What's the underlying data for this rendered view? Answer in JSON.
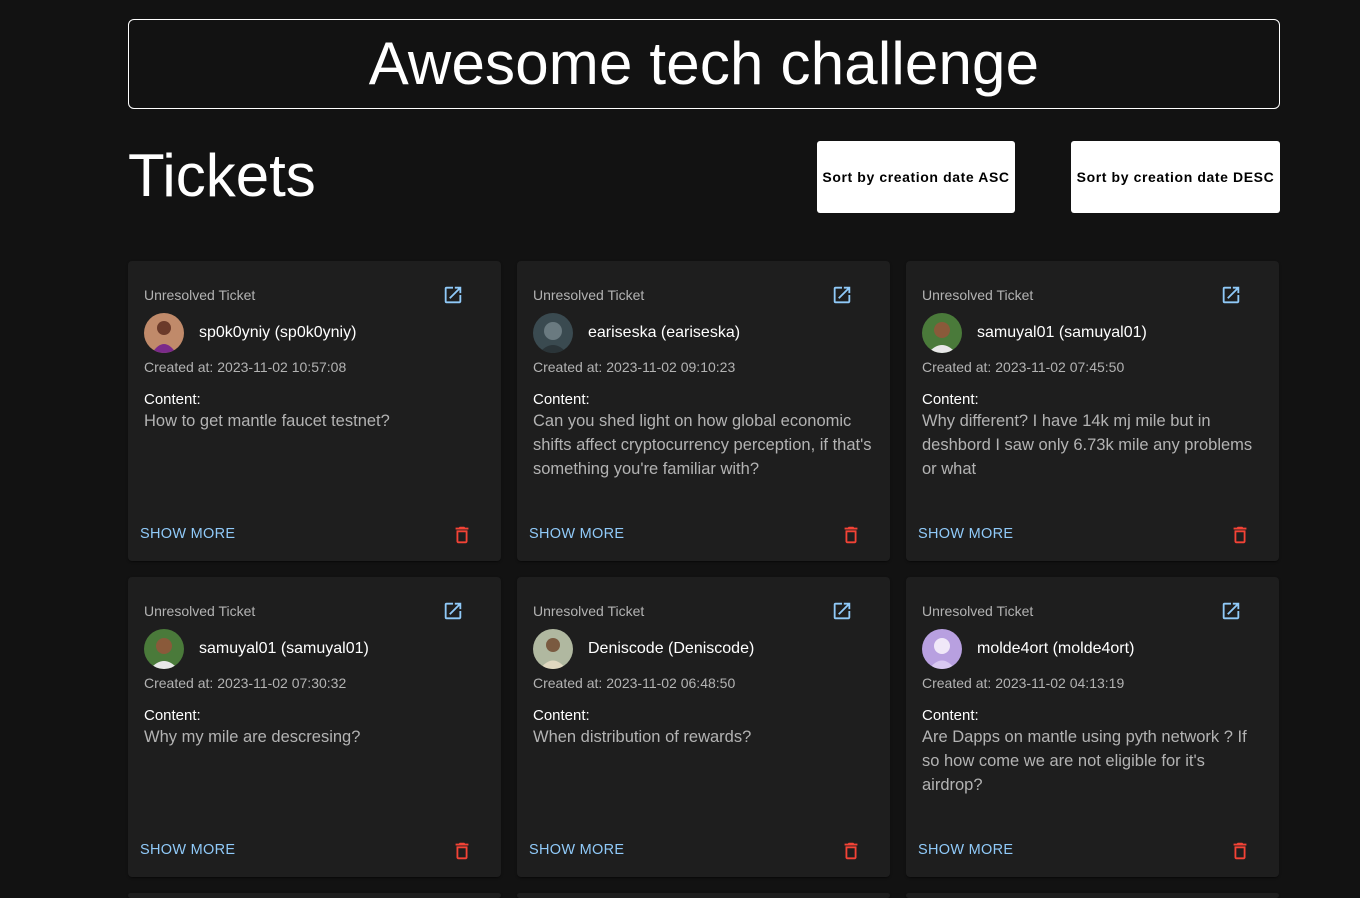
{
  "header": {
    "title": "Awesome tech challenge"
  },
  "section": {
    "title": "Tickets"
  },
  "sort": {
    "asc_label": "Sort by creation date ASC",
    "desc_label": "Sort by creation date DESC"
  },
  "labels": {
    "created_at": "Created at:",
    "content": "Content:",
    "show_more": "SHOW MORE"
  },
  "colors": {
    "background": "#121212",
    "card": "#1e1e1e",
    "accent": "#90caf9",
    "delete": "#f44336"
  },
  "tickets": [
    {
      "status": "Unresolved Ticket",
      "author": "sp0k0yniy (sp0k0yniy)",
      "created_at": "2023-11-02 10:57:08",
      "content": "How to get mantle faucet testnet?"
    },
    {
      "status": "Unresolved Ticket",
      "author": "eariseska (eariseska)",
      "created_at": "2023-11-02 09:10:23",
      "content": "Can you shed light on how global economic shifts affect cryptocurrency perception, if that's something you're familiar with?"
    },
    {
      "status": "Unresolved Ticket",
      "author": "samuyal01 (samuyal01)",
      "created_at": "2023-11-02 07:45:50",
      "content": "Why different? I have 14k mj mile but in deshbord I saw only 6.73k mile any problems or what"
    },
    {
      "status": "Unresolved Ticket",
      "author": "samuyal01 (samuyal01)",
      "created_at": "2023-11-02 07:30:32",
      "content": "Why my mile are descresing?"
    },
    {
      "status": "Unresolved Ticket",
      "author": "Deniscode (Deniscode)",
      "created_at": "2023-11-02 06:48:50",
      "content": "When distribution of rewards?"
    },
    {
      "status": "Unresolved Ticket",
      "author": "molde4ort (molde4ort)",
      "created_at": "2023-11-02 04:13:19",
      "content": "Are Dapps on mantle using pyth network ? If so how come we are not eligible for it's airdrop?"
    }
  ]
}
